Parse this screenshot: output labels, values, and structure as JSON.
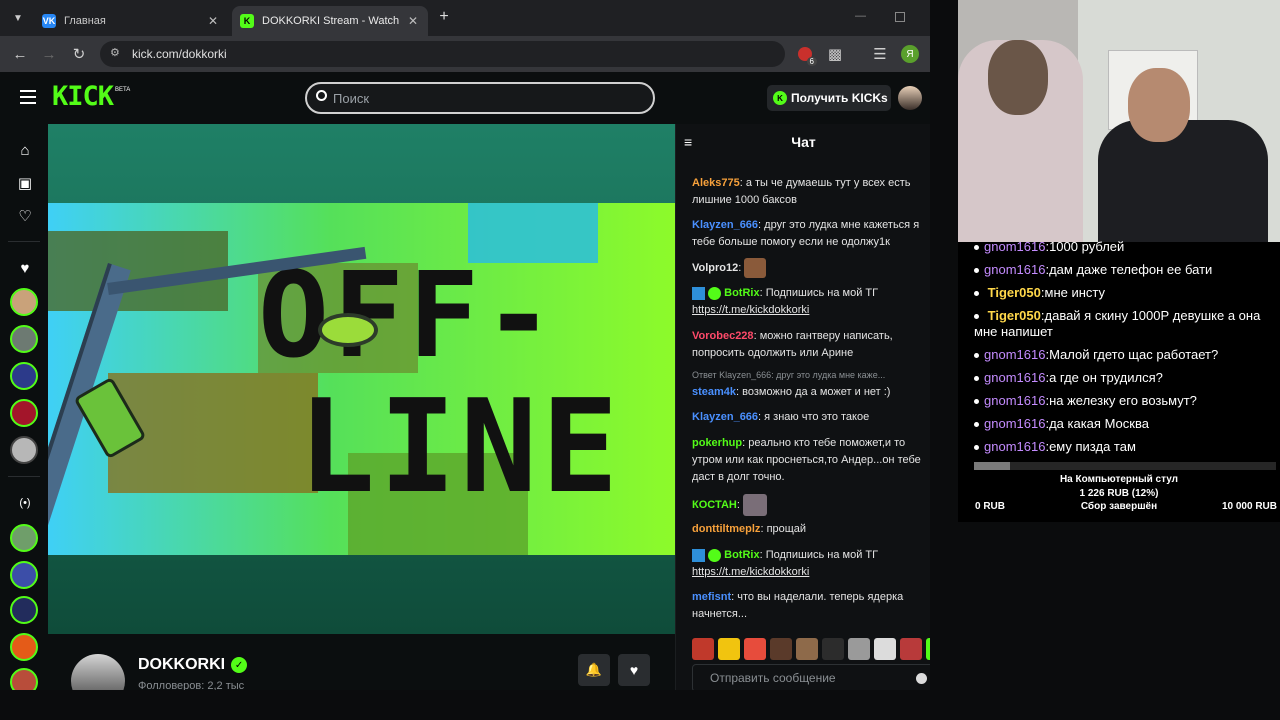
{
  "browser": {
    "tabs": [
      {
        "label": "Главная",
        "favicon": "vk-icon",
        "color": "#2787f5"
      },
      {
        "label": "DOKKORKI Stream - Watch Live",
        "favicon": "kick-icon",
        "color": "#53fc18"
      }
    ],
    "url": "kick.com/dokkorki",
    "ext_badge": "6",
    "profile": "Я"
  },
  "kick": {
    "logo": "KICK",
    "beta": "BETA",
    "search_placeholder": "Поиск",
    "get_kicks": "Получить KICKs",
    "brand_color": "#53fc18"
  },
  "video": {
    "offline_top": "OFF-",
    "offline_bottom": "LINE"
  },
  "channel": {
    "name": "DOKKORKI",
    "followers": "Фолловеров: 2,2 тыс"
  },
  "chat": {
    "title": "Чат",
    "input_placeholder": "Отправить сообщение",
    "messages": [
      {
        "user": "Aleks775",
        "color": "#f7a13b",
        "text": "а ты че думаешь тут у всех есть лишние 1000 баксов"
      },
      {
        "user": "Klayzen_666",
        "color": "#4a90ff",
        "text": "друг это лудка мне кажеться я тебе больше помогу если не одолжу1к"
      },
      {
        "user": "Volpro12",
        "color": "#e4e4e4",
        "text": ""
      },
      {
        "user": "BotRix",
        "color": "#53fc18",
        "text": "Подпишись на мой ТГ",
        "link": "https://t.me/kickdokkorki"
      },
      {
        "user": "Vorobec228",
        "color": "#ff4a6a",
        "text": "можно гантверу написать, попросить одолжить или Арине"
      },
      {
        "reply": "Ответ Klayzen_666: друг это лудка мне каже...",
        "user": "steam4k",
        "color": "#4a90ff",
        "text": "возможно да а может и нет :)"
      },
      {
        "user": "Klayzen_666",
        "color": "#4a90ff",
        "text": "я знаю что это такое"
      },
      {
        "user": "pokerhup",
        "color": "#53fc18",
        "text": "реально кто тебе поможет,и то утром или как проснеться,то Андер...он тебе даст в долг точно."
      },
      {
        "user": "КОСТАН",
        "color": "#53fc18",
        "text": ""
      },
      {
        "user": "donttiltmeplz",
        "color": "#f7a13b",
        "text": "прощай"
      },
      {
        "user": "BotRix",
        "color": "#53fc18",
        "text": "Подпишись на мой ТГ",
        "link": "https://t.me/kickdokkorki"
      },
      {
        "user": "mefisnt",
        "color": "#4a90ff",
        "text": "что вы наделали. теперь ядерка начнется..."
      }
    ]
  },
  "overlay": {
    "lines": [
      {
        "user": "gnom1616",
        "text": "1000 рублей",
        "color": "#c48cff"
      },
      {
        "user": "gnom1616",
        "text": "дам даже телефон ее бати",
        "color": "#c48cff"
      },
      {
        "user": "Tiger050",
        "text": "мне инсту",
        "color": "#ffd84a"
      },
      {
        "user": "Tiger050",
        "text": "давай я скину 1000Р девушке а она мне напишет",
        "color": "#ffd84a"
      },
      {
        "user": "gnom1616",
        "text": "Малой гдето щас работает?",
        "color": "#c48cff"
      },
      {
        "user": "gnom1616",
        "text": "а где он трудился?",
        "color": "#c48cff"
      },
      {
        "user": "gnom1616",
        "text": "на железку его возьмут?",
        "color": "#c48cff"
      },
      {
        "user": "gnom1616",
        "text": "да какая Москва",
        "color": "#c48cff"
      },
      {
        "user": "gnom1616",
        "text": "ему пизда там",
        "color": "#c48cff"
      }
    ],
    "goal": {
      "title": "На Компьютерный стул",
      "amount": "1 226 RUB (12%)",
      "min": "0 RUB",
      "status": "Сбор завершён",
      "max": "10 000 RUB",
      "progress": 0.12
    }
  }
}
